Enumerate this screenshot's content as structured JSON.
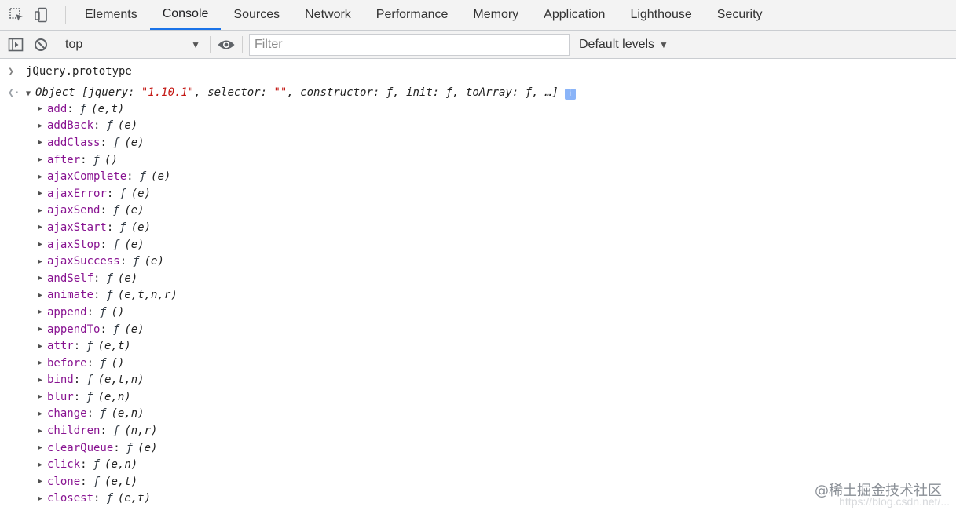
{
  "devtools": {
    "tabs": [
      {
        "label": "Elements"
      },
      {
        "label": "Console"
      },
      {
        "label": "Sources"
      },
      {
        "label": "Network"
      },
      {
        "label": "Performance"
      },
      {
        "label": "Memory"
      },
      {
        "label": "Application"
      },
      {
        "label": "Lighthouse"
      },
      {
        "label": "Security"
      }
    ],
    "active_tab": "Console",
    "accent_color": "#1a73e8"
  },
  "toolbar": {
    "context": "top",
    "filter_placeholder": "Filter",
    "levels_label": "Default levels"
  },
  "console": {
    "input_text": "jQuery.prototype",
    "object_head": {
      "label": "Object [jquery: ",
      "jquery_value": "\"1.10.1\"",
      "mid1": ", selector: ",
      "selector_value": "\"\"",
      "tail": ", constructor: ƒ, init: ƒ, toArray: ƒ, …]"
    },
    "properties": [
      {
        "name": "add",
        "sig": "(e,t)"
      },
      {
        "name": "addBack",
        "sig": "(e)"
      },
      {
        "name": "addClass",
        "sig": "(e)"
      },
      {
        "name": "after",
        "sig": "()"
      },
      {
        "name": "ajaxComplete",
        "sig": "(e)"
      },
      {
        "name": "ajaxError",
        "sig": "(e)"
      },
      {
        "name": "ajaxSend",
        "sig": "(e)"
      },
      {
        "name": "ajaxStart",
        "sig": "(e)"
      },
      {
        "name": "ajaxStop",
        "sig": "(e)"
      },
      {
        "name": "ajaxSuccess",
        "sig": "(e)"
      },
      {
        "name": "andSelf",
        "sig": "(e)"
      },
      {
        "name": "animate",
        "sig": "(e,t,n,r)"
      },
      {
        "name": "append",
        "sig": "()"
      },
      {
        "name": "appendTo",
        "sig": "(e)"
      },
      {
        "name": "attr",
        "sig": "(e,t)"
      },
      {
        "name": "before",
        "sig": "()"
      },
      {
        "name": "bind",
        "sig": "(e,t,n)"
      },
      {
        "name": "blur",
        "sig": "(e,n)"
      },
      {
        "name": "change",
        "sig": "(e,n)"
      },
      {
        "name": "children",
        "sig": "(n,r)"
      },
      {
        "name": "clearQueue",
        "sig": "(e)"
      },
      {
        "name": "click",
        "sig": "(e,n)"
      },
      {
        "name": "clone",
        "sig": "(e,t)"
      },
      {
        "name": "closest",
        "sig": "(e,t)"
      }
    ]
  },
  "watermark": {
    "text": "@稀土掘金技术社区",
    "url": "https://blog.csdn.net/..."
  }
}
